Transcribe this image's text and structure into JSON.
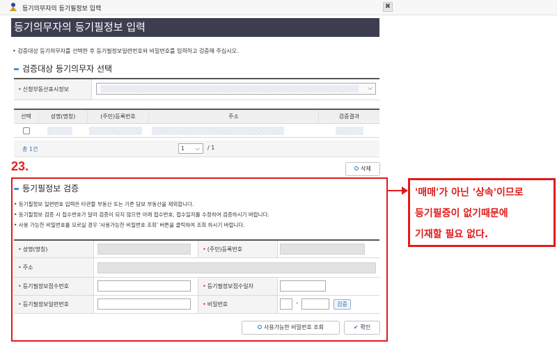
{
  "window": {
    "title": "등기의무자의 등기필정보 입력",
    "close_label": "✖"
  },
  "page": {
    "heading": "등기의무자의 등기필정보 입력",
    "intro": "• 검증대상 등기의무자를 선택한 후 등기필정보일련번호와 비밀번호를 입력하고 검증해 주십시오."
  },
  "section1": {
    "title": "검증대상 등기의무자 선택",
    "property_label": "신청부동산표시정보",
    "property_value": ""
  },
  "table": {
    "columns": [
      "선택",
      "성명(명칭)",
      "(주민)등록번호",
      "주소",
      "검증결과"
    ],
    "rows": [
      {
        "name": "",
        "reg_no": "",
        "address": "",
        "result": ""
      }
    ],
    "total": "총 1건",
    "page_current": "1",
    "page_total": "/ 1",
    "delete_label": "삭제"
  },
  "annotation": {
    "number": "23.",
    "callout_lines": [
      "'매매'가 아닌 '상속'이므로",
      "등기필증이 없기때문에",
      "기재할 필요 없다."
    ]
  },
  "section2": {
    "title": "등기필정보 검증",
    "notes": [
      "• 등기필정보 일련번호 입력은 타관할 부동산 또는 기존 담보 부동산을 제외합니다.",
      "• 등기필정보 검증 시 접수번호가 달라 검증이 되지 않으면 아래 접수번호, 접수일자를 수정하여 검증하시기 바랍니다.",
      "• 사용 가능한 비밀번호를 모르실 경우 '사용가능한 비밀번호 조회' 버튼을 클릭하여 조회 하시기 바랍니다."
    ],
    "labels": {
      "name": "성명(명칭)",
      "reg_no": "(주민)등록번호",
      "address": "주소",
      "receipt_no": "등기필정보접수번호",
      "receipt_date": "등기필정보접수일자",
      "serial_no": "등기필정보일련번호",
      "password": "비밀번호"
    },
    "password_sep": "-",
    "verify_label": "검증",
    "lookup_label": "사용가능한 비밀번호 조회",
    "confirm_label": "확인"
  }
}
